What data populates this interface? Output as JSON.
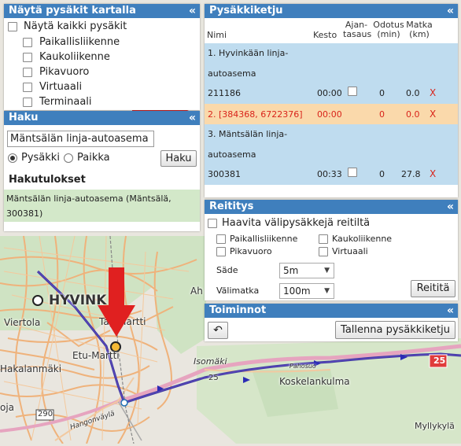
{
  "colors": {
    "header": "#3f7fbd",
    "selected_row": "#fad9ab",
    "stop_row": "#bfdcef",
    "route_line": "#3a3aa0",
    "arrow": "#e02020"
  },
  "show_stops_panel": {
    "title": "Näytä pysäkit kartalla",
    "collapse_icon": "«",
    "all_label": "Näytä kaikki pysäkit",
    "options": [
      "Paikallisliikenne",
      "Kaukoliikenne",
      "Pikavuoro",
      "Virtuaali",
      "Terminaali"
    ]
  },
  "search_panel": {
    "title": "Haku",
    "collapse_icon": "«",
    "input_value": "Mäntsälän linja-autoasema",
    "radio_stop": "Pysäkki",
    "radio_place": "Paikka",
    "search_button": "Haku",
    "results_heading": "Hakutulokset",
    "result_line1": "Mäntsälän linja-autoasema (Mäntsälä,",
    "result_line2": "300381)"
  },
  "chain_panel": {
    "title": "Pysäkkiketju",
    "collapse_icon": "«",
    "headers": {
      "name": "Nimi",
      "duration": "Kesto",
      "timing1": "Ajan-",
      "timing2": "tasaus",
      "wait1": "Odotus",
      "wait2": "(min)",
      "dist1": "Matka",
      "dist2": "(km)"
    },
    "rows": [
      {
        "name1": "1. Hyvinkään linja-",
        "name2": "autoasema",
        "code": "211186",
        "time": "00:00",
        "wait": "0",
        "dist": "0.0",
        "remove": "X"
      },
      {
        "name1": "2. [384368, 6722376]",
        "time": "00:00",
        "wait": "0",
        "dist": "0.0",
        "remove": "X"
      },
      {
        "name1": "3. Mäntsälän linja-",
        "name2": "autoasema",
        "code": "300381",
        "time": "00:33",
        "wait": "0",
        "dist": "27.8",
        "remove": "X"
      }
    ]
  },
  "routing_panel": {
    "title": "Reititys",
    "collapse_icon": "«",
    "search_between_label": "Haavita välipysäkkejä reitiltä",
    "opt_local": "Paikallisliikenne",
    "opt_long": "Kaukoliikenne",
    "opt_express": "Pikavuoro",
    "opt_virtual": "Virtuaali",
    "radius_label": "Säde",
    "radius_value": "5m",
    "interval_label": "Välimatka",
    "interval_value": "100m",
    "route_button": "Reititä"
  },
  "actions_panel": {
    "title": "Toiminnot",
    "collapse_icon": "«",
    "undo_icon": "↶",
    "save_button": "Tallenna pysäkkiketju"
  },
  "map": {
    "labels": {
      "hyvinkaa": "HYVINK",
      "viertola": "Viertola",
      "tapainen_martti": "Tap Martti",
      "etu_martti": "Etu-Martti",
      "hakalanmaki": "Hakalanmäki",
      "koskelankulma": "Koskelankulma",
      "isomaki": "Isomäki",
      "pahosuo": "Pahosuo",
      "myllykyla": "Myllykylä",
      "ahv": "Ah",
      "road25a": "25",
      "road25b": "25",
      "road290": "290",
      "hangonvayla": "Hangonväylä",
      "oja": "oja"
    }
  }
}
